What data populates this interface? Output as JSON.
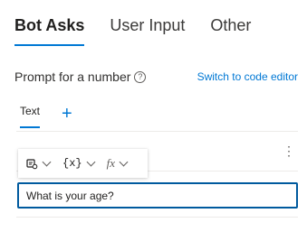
{
  "tabs": [
    {
      "label": "Bot Asks",
      "active": true
    },
    {
      "label": "User Input",
      "active": false
    },
    {
      "label": "Other",
      "active": false
    }
  ],
  "prompt": {
    "label": "Prompt for a number",
    "help_icon": "question-circle-icon"
  },
  "switch_link": "Switch to code editor",
  "sub_tabs": [
    {
      "label": "Text"
    }
  ],
  "add_icon": "+",
  "more_icon": "⋮",
  "toolbar": {
    "items": [
      {
        "name": "insert-template-icon"
      },
      {
        "name": "variable-icon",
        "label": "{x}"
      },
      {
        "name": "function-icon",
        "label": "fx"
      }
    ]
  },
  "input": {
    "value": "What is your age?"
  },
  "colors": {
    "accent": "#0078d4",
    "focus_border": "#005a9e"
  }
}
